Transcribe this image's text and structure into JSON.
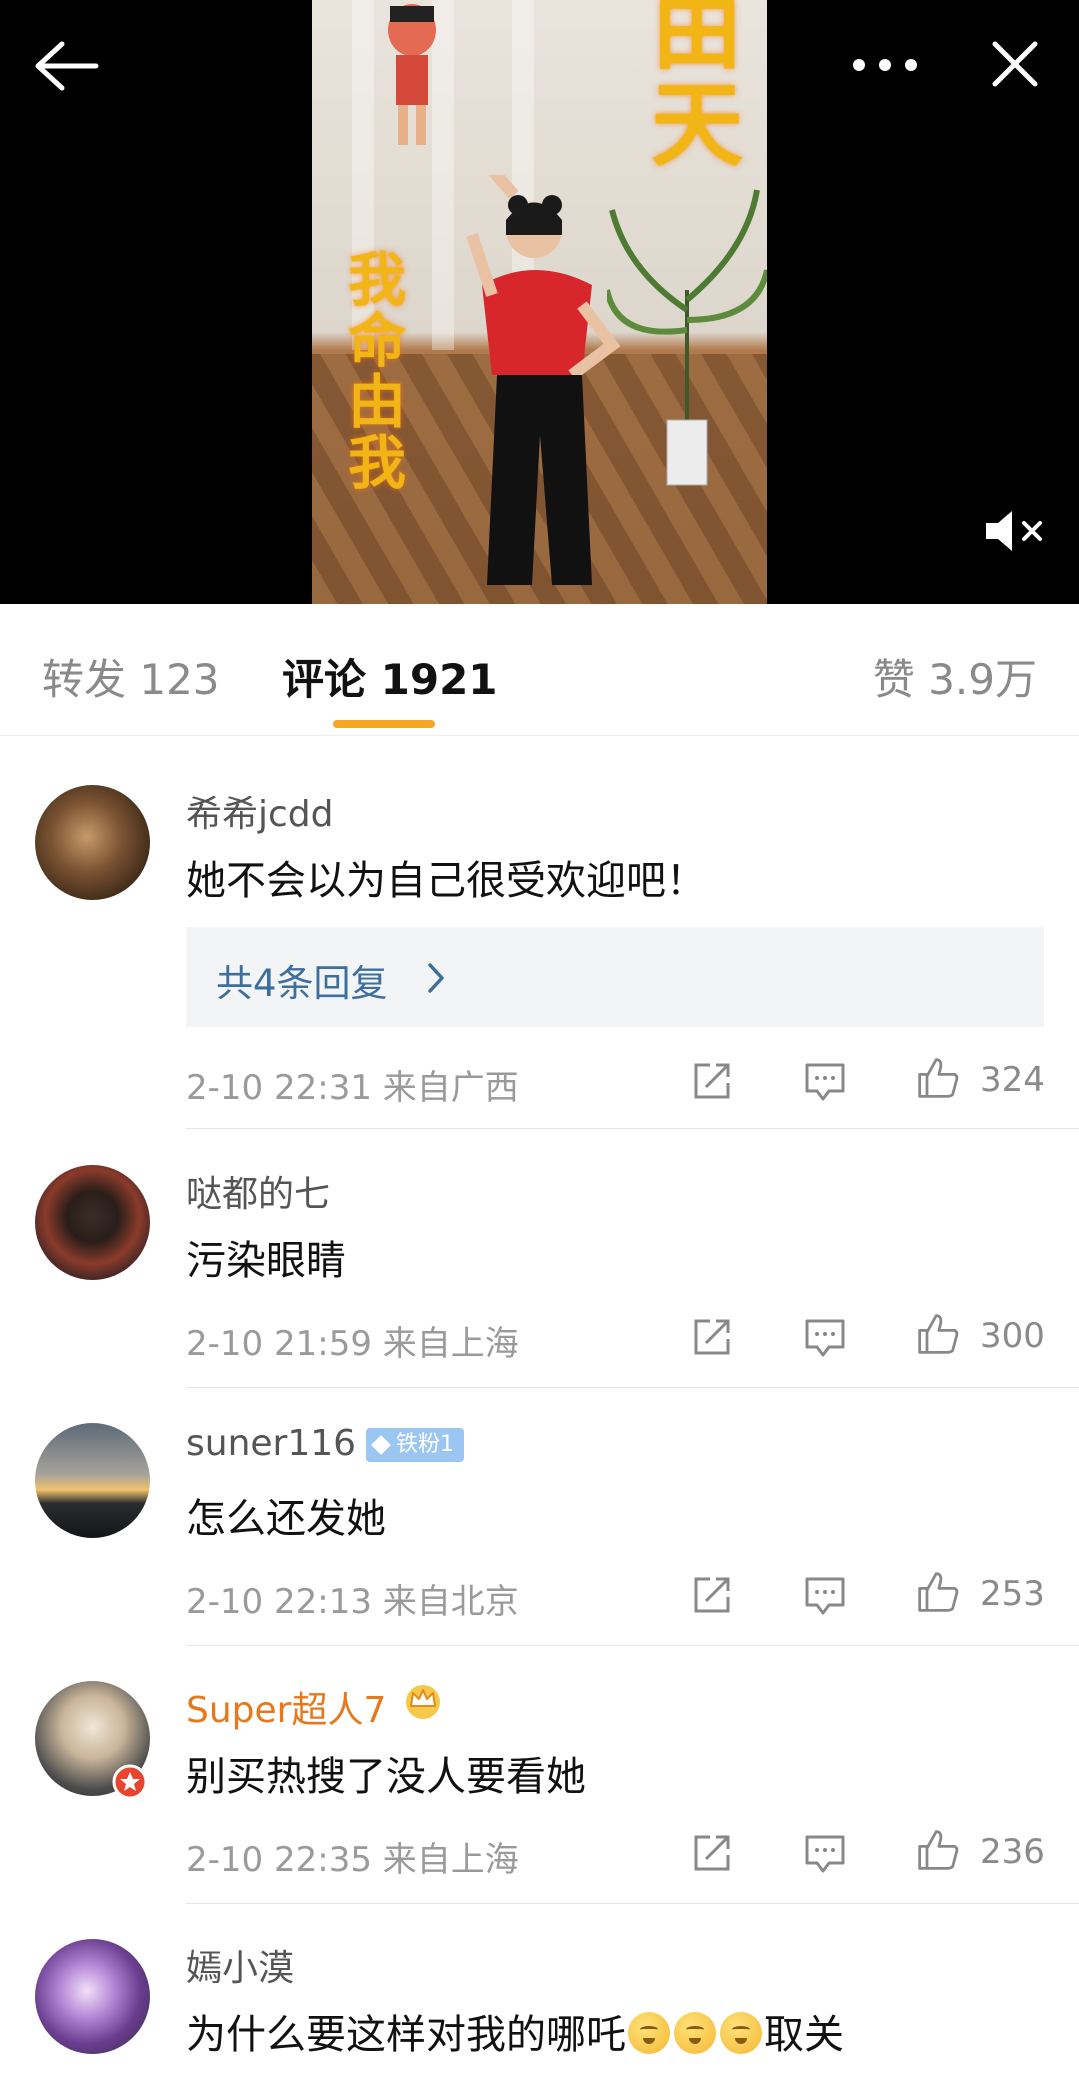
{
  "video": {
    "overlay_title": "由天",
    "overlay_side": "我命由我"
  },
  "tabs": {
    "repost": "转发 123",
    "comments": "评论 1921",
    "likes": "赞 3.9万"
  },
  "comments": [
    {
      "user": "希希jcdd",
      "text": "她不会以为自己很受欢迎吧！",
      "replies_label": "共4条回复",
      "time_location": "2-10 22:31 来自广西",
      "likes": "324"
    },
    {
      "user": "哒都的七",
      "text": "污染眼睛",
      "time_location": "2-10 21:59 来自上海",
      "likes": "300"
    },
    {
      "user": "suner116",
      "badge": "铁粉1",
      "text": "怎么还发她",
      "time_location": "2-10 22:13 来自北京",
      "likes": "253"
    },
    {
      "user": "Super超人7",
      "text": "别买热搜了没人要看她",
      "time_location": "2-10 22:35 来自上海",
      "likes": "236"
    },
    {
      "user": "嫣小漠",
      "text_prefix": "为什么要这样对我的哪吒",
      "text_suffix": "取关",
      "emoji": "weary-face-emoji"
    }
  ],
  "colors": {
    "accent": "#f5a623",
    "link": "#3d6f9e",
    "vip_name": "#e7781c",
    "badge": "#9cc6f2"
  }
}
